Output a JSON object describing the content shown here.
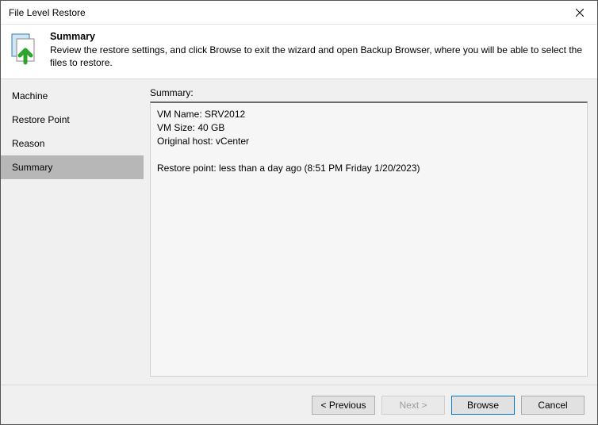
{
  "window": {
    "title": "File Level Restore"
  },
  "header": {
    "title": "Summary",
    "description": "Review the restore settings, and click Browse to exit the wizard and open Backup Browser, where you will be able to select the files to restore."
  },
  "sidebar": {
    "items": [
      {
        "label": "Machine",
        "active": false
      },
      {
        "label": "Restore Point",
        "active": false
      },
      {
        "label": "Reason",
        "active": false
      },
      {
        "label": "Summary",
        "active": true
      }
    ]
  },
  "main": {
    "summary_label": "Summary:",
    "summary_lines": [
      "VM Name: SRV2012",
      "VM Size: 40 GB",
      "Original host: vCenter",
      "",
      "Restore point: less than a day ago (8:51 PM Friday 1/20/2023)"
    ]
  },
  "footer": {
    "previous": "< Previous",
    "next": "Next >",
    "browse": "Browse",
    "cancel": "Cancel"
  }
}
